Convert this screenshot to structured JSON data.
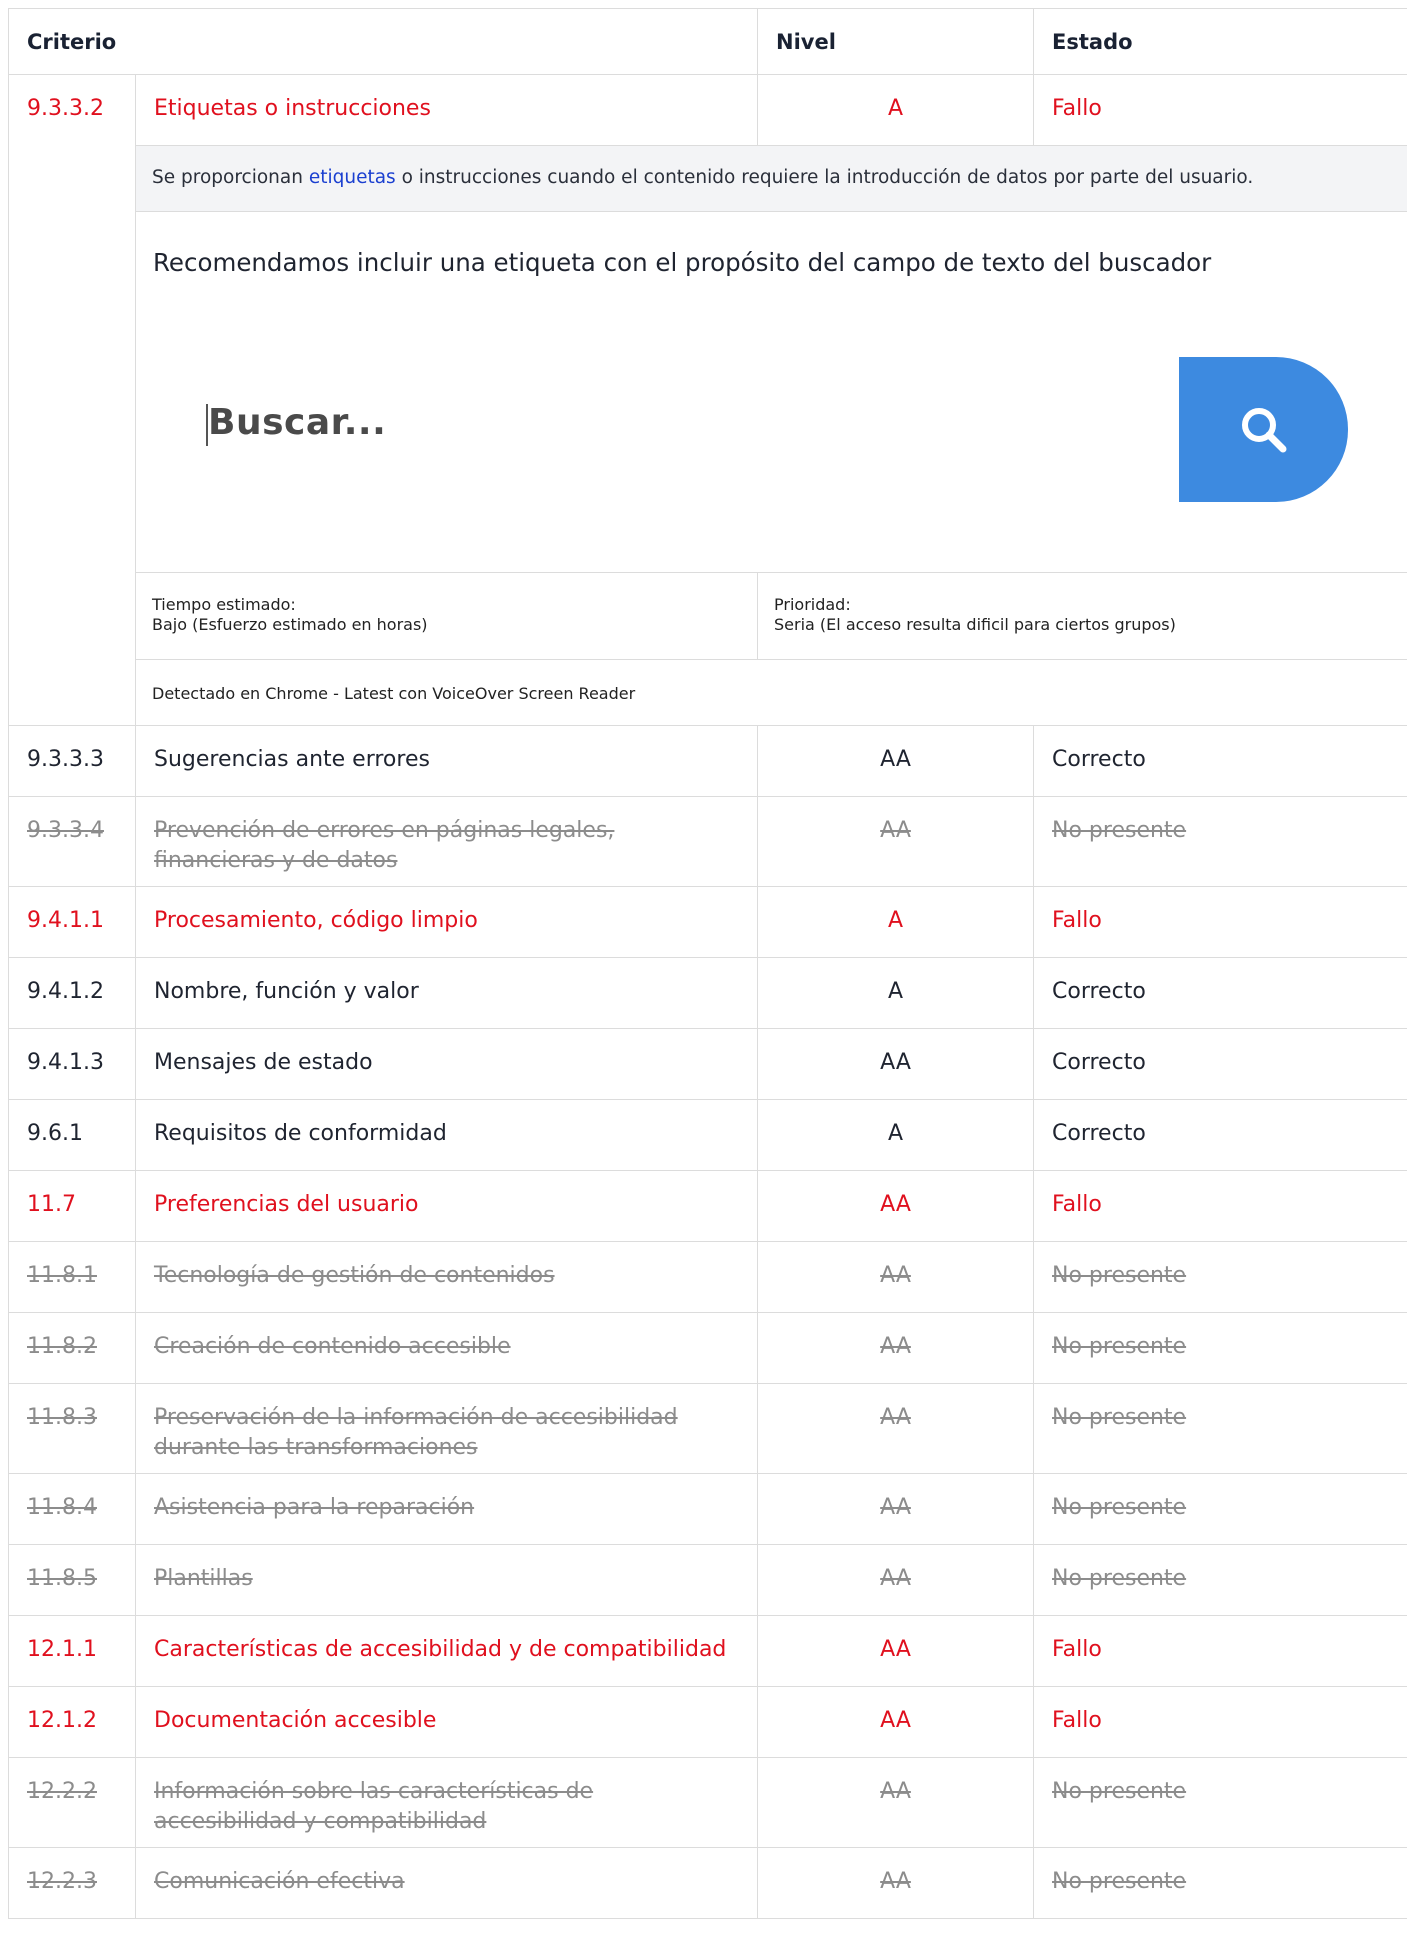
{
  "header": {
    "criterio": "Criterio",
    "nivel": "Nivel",
    "estado": "Estado"
  },
  "expanded": {
    "id": "9.3.3.2",
    "name": "Etiquetas o instrucciones",
    "nivel": "A",
    "estado": "Fallo",
    "description": {
      "before": "Se proporcionan ",
      "link": "etiquetas",
      "after": " o instrucciones cuando el contenido requiere la introducción de datos por parte del usuario."
    },
    "recommendation": "Recomendamos incluir una etiqueta con el propósito del campo de texto del buscador",
    "search_placeholder": "Buscar...",
    "search_icon": "search-icon",
    "search_button_color": "#3d8ae0",
    "tiempo_label": "Tiempo estimado:",
    "tiempo_value": "Bajo (Esfuerzo estimado en horas)",
    "prioridad_label": "Prioridad:",
    "prioridad_value": "Seria (El acceso resulta dificil para ciertos grupos)",
    "detected": "Detectado en Chrome - Latest con VoiceOver Screen Reader"
  },
  "rows": [
    {
      "id": "9.3.3.3",
      "name": "Sugerencias ante errores",
      "nivel": "AA",
      "estado": "Correcto"
    },
    {
      "id": "9.3.3.4",
      "name": "Prevención de errores en páginas legales, financieras y de datos",
      "nivel": "AA",
      "estado": "No presente"
    },
    {
      "id": "9.4.1.1",
      "name": "Procesamiento, código limpio",
      "nivel": "A",
      "estado": "Fallo"
    },
    {
      "id": "9.4.1.2",
      "name": "Nombre, función y valor",
      "nivel": "A",
      "estado": "Correcto"
    },
    {
      "id": "9.4.1.3",
      "name": "Mensajes de estado",
      "nivel": "AA",
      "estado": "Correcto"
    },
    {
      "id": "9.6.1",
      "name": "Requisitos de conformidad",
      "nivel": "A",
      "estado": "Correcto"
    },
    {
      "id": "11.7",
      "name": "Preferencias del usuario",
      "nivel": "AA",
      "estado": "Fallo"
    },
    {
      "id": "11.8.1",
      "name": "Tecnología de gestión de contenidos",
      "nivel": "AA",
      "estado": "No presente"
    },
    {
      "id": "11.8.2",
      "name": "Creación de contenido accesible",
      "nivel": "AA",
      "estado": "No presente"
    },
    {
      "id": "11.8.3",
      "name": "Preservación de la información de accesibilidad durante las transformaciones",
      "nivel": "AA",
      "estado": "No presente"
    },
    {
      "id": "11.8.4",
      "name": "Asistencia para la reparación",
      "nivel": "AA",
      "estado": "No presente"
    },
    {
      "id": "11.8.5",
      "name": "Plantillas",
      "nivel": "AA",
      "estado": "No presente"
    },
    {
      "id": "12.1.1",
      "name": "Características de accesibilidad y de compatibilidad",
      "nivel": "AA",
      "estado": "Fallo"
    },
    {
      "id": "12.1.2",
      "name": "Documentación accesible",
      "nivel": "AA",
      "estado": "Fallo"
    },
    {
      "id": "12.2.2",
      "name": "Información sobre las características de accesibilidad y compatibilidad",
      "nivel": "AA",
      "estado": "No presente"
    },
    {
      "id": "12.2.3",
      "name": "Comunicación efectiva",
      "nivel": "AA",
      "estado": "No presente"
    }
  ],
  "colors": {
    "fallo": "#e0101e",
    "no_presente": "#8c8c8c",
    "correcto": "#1f2430",
    "link": "#1a3fd0"
  }
}
